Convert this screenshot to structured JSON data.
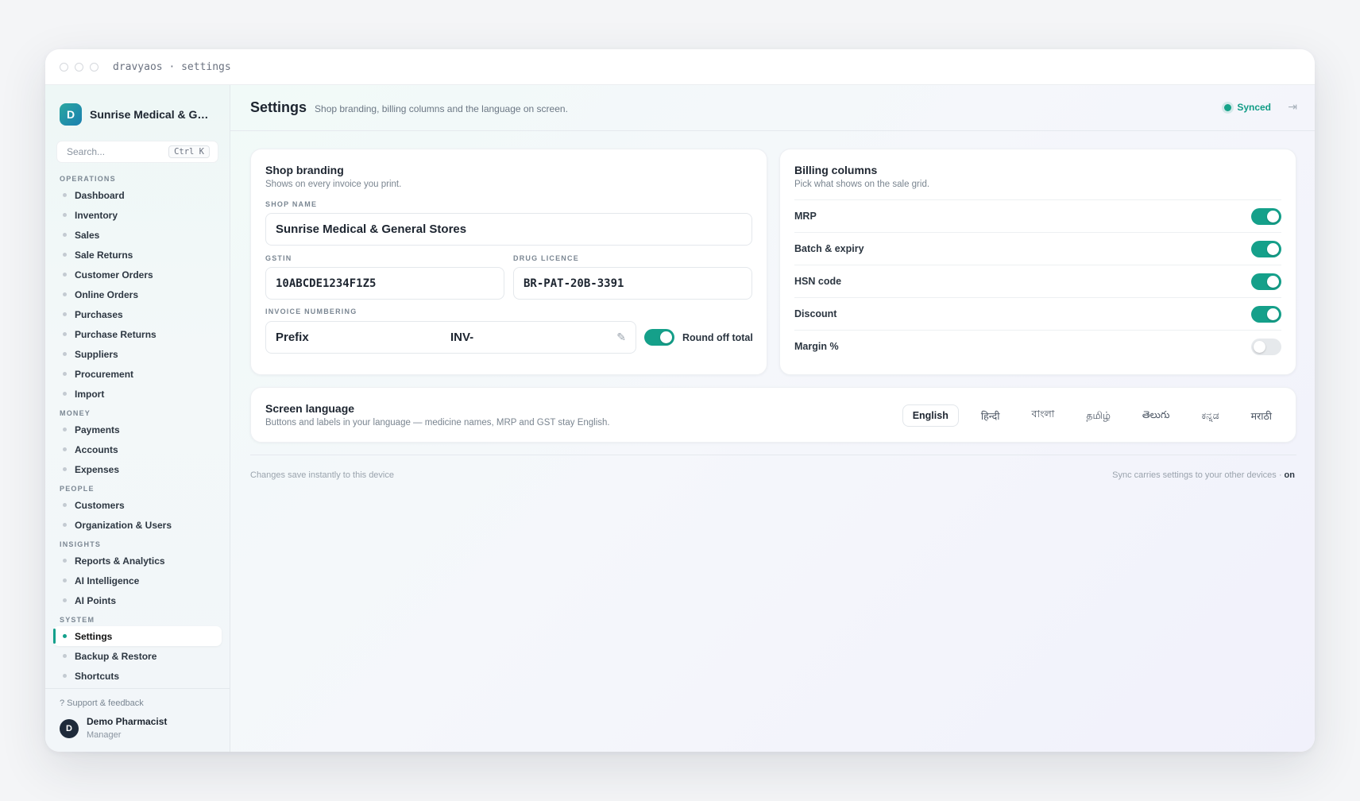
{
  "window": {
    "title": "dravyaos · settings"
  },
  "sidebar": {
    "brand_initial": "D",
    "brand_name": "Sunrise Medical & General Stores",
    "search_placeholder": "Search...",
    "search_shortcut": "Ctrl K",
    "sections": [
      {
        "label": "OPERATIONS",
        "items": [
          "Dashboard",
          "Inventory",
          "Sales",
          "Sale Returns",
          "Customer Orders",
          "Online Orders",
          "Purchases",
          "Purchase Returns",
          "Suppliers",
          "Procurement",
          "Import"
        ]
      },
      {
        "label": "MONEY",
        "items": [
          "Payments",
          "Accounts",
          "Expenses"
        ]
      },
      {
        "label": "PEOPLE",
        "items": [
          "Customers",
          "Organization & Users"
        ]
      },
      {
        "label": "INSIGHTS",
        "items": [
          "Reports & Analytics",
          "AI Intelligence",
          "AI Points"
        ]
      },
      {
        "label": "SYSTEM",
        "items": [
          "Settings",
          "Backup & Restore",
          "Shortcuts"
        ]
      }
    ],
    "active_item": "Settings",
    "support_link": "? Support & feedback",
    "user": {
      "initial": "D",
      "name": "Demo Pharmacist",
      "role": "Manager"
    }
  },
  "header": {
    "title": "Settings",
    "subtitle": "Shop branding, billing columns and the language on screen.",
    "sync_status": "Synced"
  },
  "shop_branding": {
    "title": "Shop branding",
    "subtitle": "Shows on every invoice you print.",
    "shop_name_label": "SHOP NAME",
    "shop_name": "Sunrise Medical & General Stores",
    "gstin_label": "GSTIN",
    "gstin": "10ABCDE1234F1Z5",
    "drug_licence_label": "DRUG LICENCE",
    "drug_licence": "BR-PAT-20B-3391",
    "invoice_numbering_label": "INVOICE NUMBERING",
    "prefix_label": "Prefix",
    "prefix_value": "INV-",
    "round_off_label": "Round off total",
    "round_off_on": true
  },
  "billing_columns": {
    "title": "Billing columns",
    "subtitle": "Pick what shows on the sale grid.",
    "columns": [
      {
        "label": "MRP",
        "on": true
      },
      {
        "label": "Batch & expiry",
        "on": true
      },
      {
        "label": "HSN code",
        "on": true
      },
      {
        "label": "Discount",
        "on": true
      },
      {
        "label": "Margin %",
        "on": false
      }
    ]
  },
  "screen_language": {
    "title": "Screen language",
    "subtitle": "Buttons and labels in your language — medicine names, MRP and GST stay English.",
    "languages": [
      "English",
      "हिन्दी",
      "বাংলা",
      "தமிழ்",
      "తెలుగు",
      "ಕನ್ನಡ",
      "मराठी"
    ],
    "selected": "English"
  },
  "footer": {
    "left": "Changes save instantly to this device",
    "right": "Sync carries settings to your other devices ·",
    "right_state": "on"
  },
  "colors": {
    "accent": "#15a08a",
    "text": "#1d2530"
  }
}
